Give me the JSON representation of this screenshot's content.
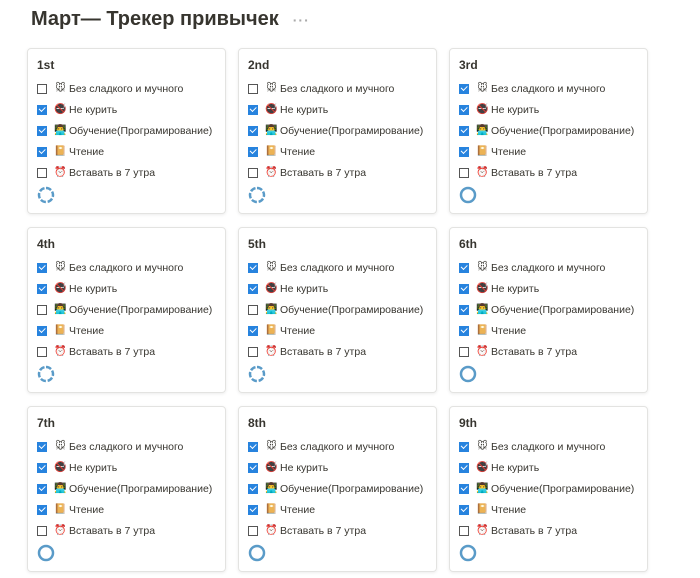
{
  "title": "Март— Трекер привычек",
  "more_label": "···",
  "habits": [
    {
      "icon": "🐭",
      "label": "Без сладкого и мучного"
    },
    {
      "icon": "🚭",
      "label": " Не курить"
    },
    {
      "icon": "👨‍💻",
      "label": "Обучение(Програмирование)"
    },
    {
      "icon": "📔",
      "label": " Чтение"
    },
    {
      "icon": "⏰",
      "label": " Вставать в 7 утра"
    }
  ],
  "ring_color": "#5a9bc8",
  "days": [
    {
      "label": "1st",
      "checked": [
        false,
        true,
        true,
        true,
        false
      ],
      "progress": 0.75
    },
    {
      "label": "2nd",
      "checked": [
        false,
        true,
        true,
        true,
        false
      ],
      "progress": 0.75
    },
    {
      "label": "3rd",
      "checked": [
        true,
        true,
        true,
        true,
        false
      ],
      "progress": 1
    },
    {
      "label": "4th",
      "checked": [
        true,
        true,
        false,
        true,
        false
      ],
      "progress": 0.75
    },
    {
      "label": "5th",
      "checked": [
        true,
        true,
        false,
        true,
        false
      ],
      "progress": 0.75
    },
    {
      "label": "6th",
      "checked": [
        true,
        true,
        true,
        true,
        false
      ],
      "progress": 1
    },
    {
      "label": "7th",
      "checked": [
        true,
        true,
        true,
        true,
        false
      ],
      "progress": 1
    },
    {
      "label": "8th",
      "checked": [
        true,
        true,
        true,
        true,
        false
      ],
      "progress": 1
    },
    {
      "label": "9th",
      "checked": [
        true,
        true,
        true,
        true,
        false
      ],
      "progress": 1
    }
  ]
}
